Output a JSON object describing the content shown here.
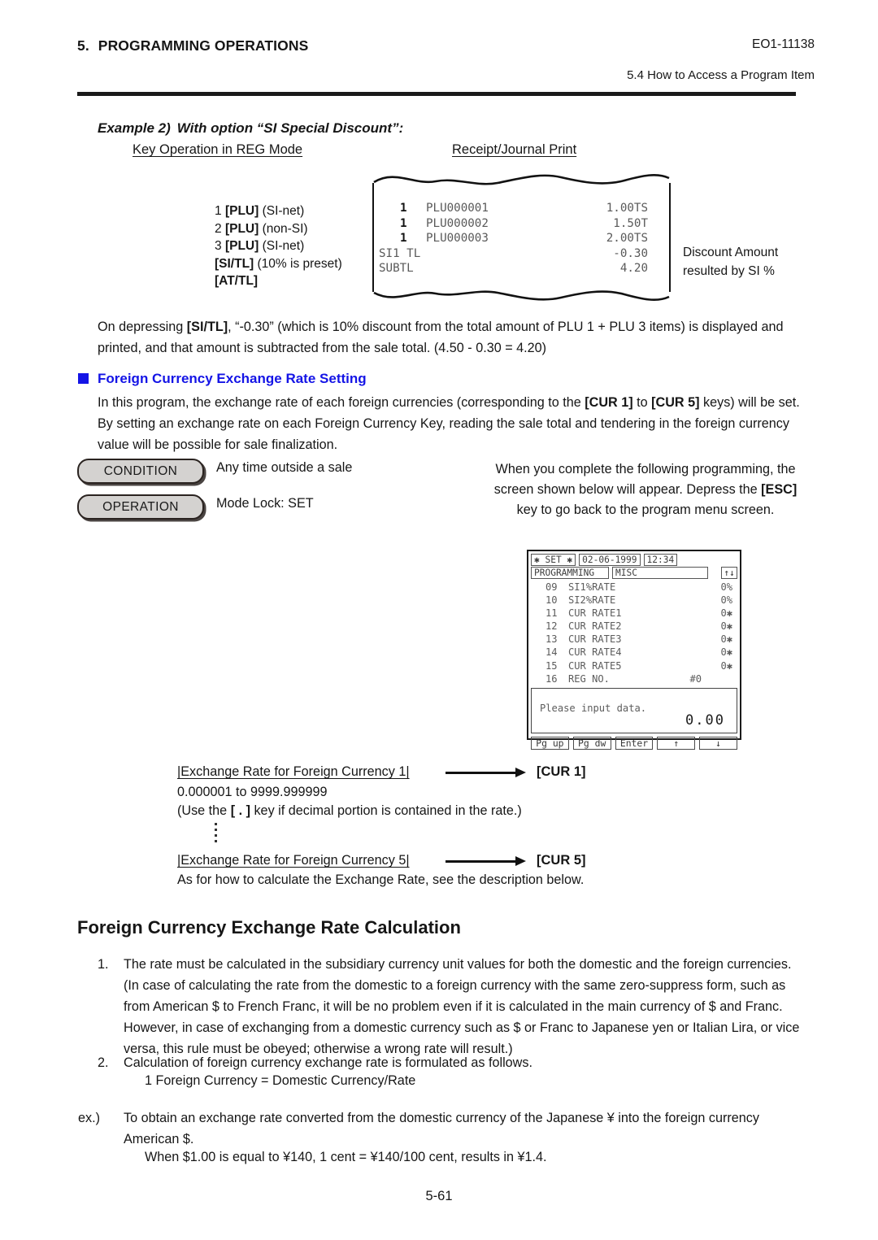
{
  "header": {
    "section_number": "5.",
    "section_title": "PROGRAMMING OPERATIONS",
    "doc_code": "EO1-11138",
    "subsection": "5.4  How to Access a Program Item"
  },
  "example": {
    "title_lead": "Example 2)",
    "title_text": "With option “SI Special Discount”:",
    "column_a_heading": "Key Operation in REG Mode",
    "column_b_heading": "Receipt/Journal Print",
    "key_operations": [
      {
        "qty": "1 ",
        "key": "[PLU]",
        "note": " (SI-net)"
      },
      {
        "qty": "2 ",
        "key": "[PLU]",
        "note": " (non-SI)"
      },
      {
        "qty": "3 ",
        "key": "[PLU]",
        "note": " (SI-net)"
      },
      {
        "qty": "",
        "key": "[SI/TL]",
        "note": " (10% is preset)"
      },
      {
        "qty": "",
        "key": "[AT/TL]",
        "note": ""
      }
    ],
    "receipt_rows": [
      {
        "qty": "1",
        "label": "PLU000001",
        "amount": "1.00TS",
        "indent": true
      },
      {
        "qty": "1",
        "label": "PLU000002",
        "amount": "1.50T",
        "indent": true
      },
      {
        "qty": "1",
        "label": "PLU000003",
        "amount": "2.00TS",
        "indent": true
      },
      {
        "qty": "",
        "label": "SI1 TL",
        "amount": "-0.30",
        "indent": false
      },
      {
        "qty": "",
        "label": "SUBTL",
        "amount": "4.20",
        "indent": false
      }
    ],
    "discount_note_line1": "Discount Amount",
    "discount_note_line2": "resulted by SI %"
  },
  "body": {
    "on_depressing": "On depressing [SI/TL], “-0.30” (which is 10% discount from the total amount of PLU 1 + PLU 3 items) is displayed and printed, and that amount is subtracted from the sale total. (4.50 - 0.30 = 4.20)",
    "section_heading": "Foreign Currency Exchange Rate Setting",
    "section_heading_color": "#1414e6",
    "in_this_program": "In this program, the exchange rate of each foreign currencies (corresponding to the [CUR 1] to [CUR 5] keys) will be set. By setting an exchange rate on each Foreign Currency Key, reading the sale total and tendering in the foreign currency value will be possible for sale finalization."
  },
  "condition_block": {
    "condition_label": "CONDITION",
    "condition_text": "Any time outside a sale",
    "operation_label": "OPERATION",
    "operation_text": "Mode Lock:  SET",
    "right_note": "When you complete the following programming, the screen shown below will appear. Depress the [ESC] key to go back to the program menu screen."
  },
  "lcd": {
    "mode": "✱ SET ✱",
    "date": "02-06-1999",
    "time": "12:34",
    "menu_main": "PROGRAMMING",
    "menu_sub": "MISC",
    "scroll_icon": "↑↓",
    "items": [
      {
        "index": "09",
        "name": "SI1%RATE",
        "value": "0%",
        "hash": false
      },
      {
        "index": "10",
        "name": "SI2%RATE",
        "value": "0%",
        "hash": false
      },
      {
        "index": "11",
        "name": "CUR RATE1",
        "value": "0✱",
        "hash": false
      },
      {
        "index": "12",
        "name": "CUR RATE2",
        "value": "0✱",
        "hash": false
      },
      {
        "index": "13",
        "name": "CUR RATE3",
        "value": "0✱",
        "hash": false
      },
      {
        "index": "14",
        "name": "CUR RATE4",
        "value": "0✱",
        "hash": false
      },
      {
        "index": "15",
        "name": "CUR RATE5",
        "value": "0✱",
        "hash": false
      },
      {
        "index": "16",
        "name": "REG NO.",
        "value": "#0",
        "hash": true
      }
    ],
    "prompt": "Please input data.",
    "amount": "0.00",
    "keys": [
      "Pg up",
      "Pg dw",
      "Enter",
      "↑",
      "↓"
    ]
  },
  "exchange": {
    "line1_label": "|Exchange Rate for Foreign Currency 1|",
    "line1_key": "[CUR 1]",
    "range": "0.000001 to 9999.999999",
    "use_note_pre": "(Use the ",
    "use_note_key": "[ . ]",
    "use_note_post": " key if decimal portion is contained in the rate.)",
    "line5_label": "|Exchange Rate for Foreign Currency 5|",
    "line5_key": "[CUR 5]",
    "description": "As for how to calculate the Exchange Rate, see the description below."
  },
  "calculation": {
    "heading": "Foreign Currency Exchange Rate Calculation",
    "item1_marker": "1.",
    "item1": "The rate must be calculated in the subsidiary currency unit values for both the domestic and the foreign currencies. (In case of calculating the rate from the domestic to a foreign currency with the same zero-suppress form, such as from American $ to French Franc, it will be no problem even if it is calculated in the main currency of $ and Franc. However, in case of exchanging from a domestic currency such as $ or Franc to Japanese yen or Italian Lira, or vice versa, this rule must be obeyed;  otherwise a wrong rate will result.)",
    "item2_marker": "2.",
    "item2": "Calculation of foreign currency exchange rate is formulated as follows.",
    "item2_formula": "1 Foreign Currency = Domestic Currency/Rate",
    "ex_marker": "ex.)",
    "ex_text": "To obtain an exchange rate converted from the domestic currency of the Japanese ¥ into the foreign currency American $.",
    "ex_sub": "When $1.00 is equal to ¥140, 1 cent = ¥140/100 cent, results in ¥1.4."
  },
  "footer": {
    "page_number": "5-61"
  }
}
